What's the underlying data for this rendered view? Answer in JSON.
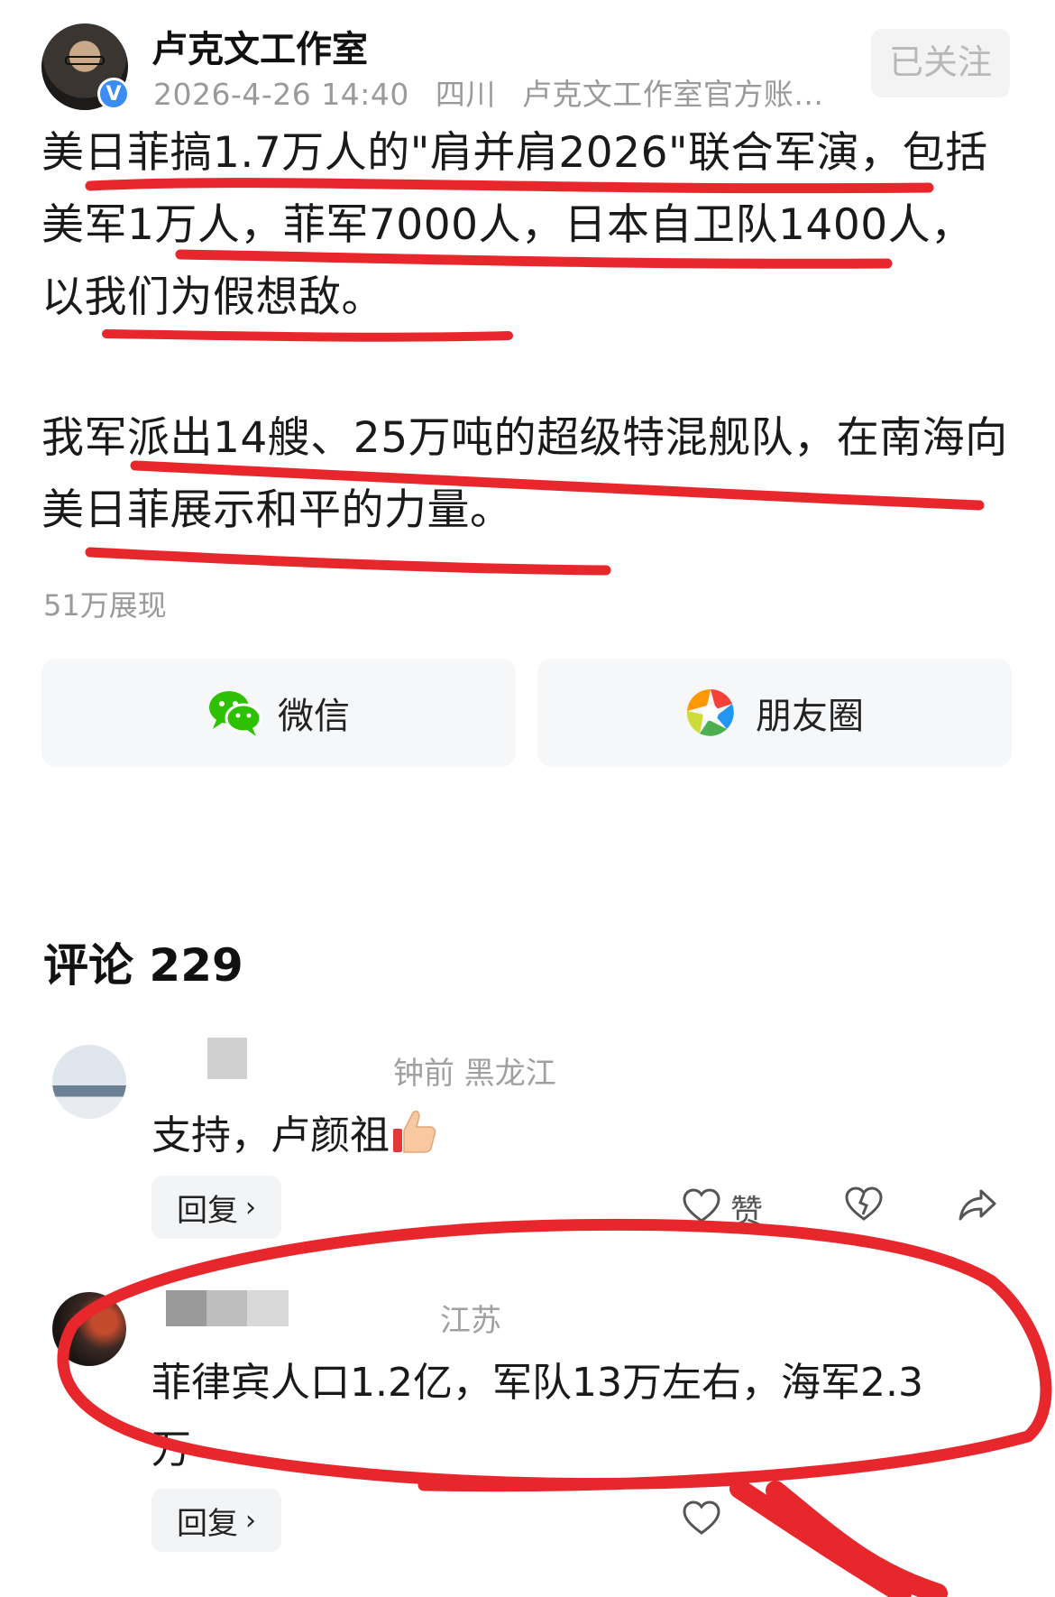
{
  "header": {
    "author": "卢克文工作室",
    "verified_badge": "V",
    "time": "2026-4-26 14:40",
    "location": "四川",
    "account_desc": "卢克文工作室官方账...",
    "follow_label": "已关注"
  },
  "post": {
    "paragraph1": "美日菲搞1.7万人的\"肩并肩2026\"联合军演，包括美军1万人，菲军7000人，日本自卫队1400人，以我们为假想敌。",
    "paragraph2": "我军派出14艘、25万吨的超级特混舰队，在南海向美日菲展示和平的力量。",
    "views": "51万展现"
  },
  "share": {
    "wechat_label": "微信",
    "moments_label": "朋友圈"
  },
  "comments": {
    "title": "评论 229",
    "items": [
      {
        "meta": "钟前  黑龙江",
        "text": "支持，卢颜祖",
        "reply_label": "回复",
        "like_label": "赞"
      },
      {
        "meta": "江苏",
        "text_line1": "菲律宾人口1.2亿，军队13万左右，海军2.3",
        "text_line2": "万",
        "reply_label": "回复"
      }
    ]
  },
  "icons": {
    "verified": "verified-icon",
    "wechat": "wechat-icon",
    "moments": "moments-icon",
    "heart": "heart-icon",
    "broken_heart": "dislike-heart-icon",
    "share": "share-arrow-icon",
    "thumbs_up": "thumbs-up-emoji"
  },
  "colors": {
    "annotation_red": "#e8272c",
    "wechat_green": "#2dc100",
    "verified_blue": "#3b8cf3"
  }
}
